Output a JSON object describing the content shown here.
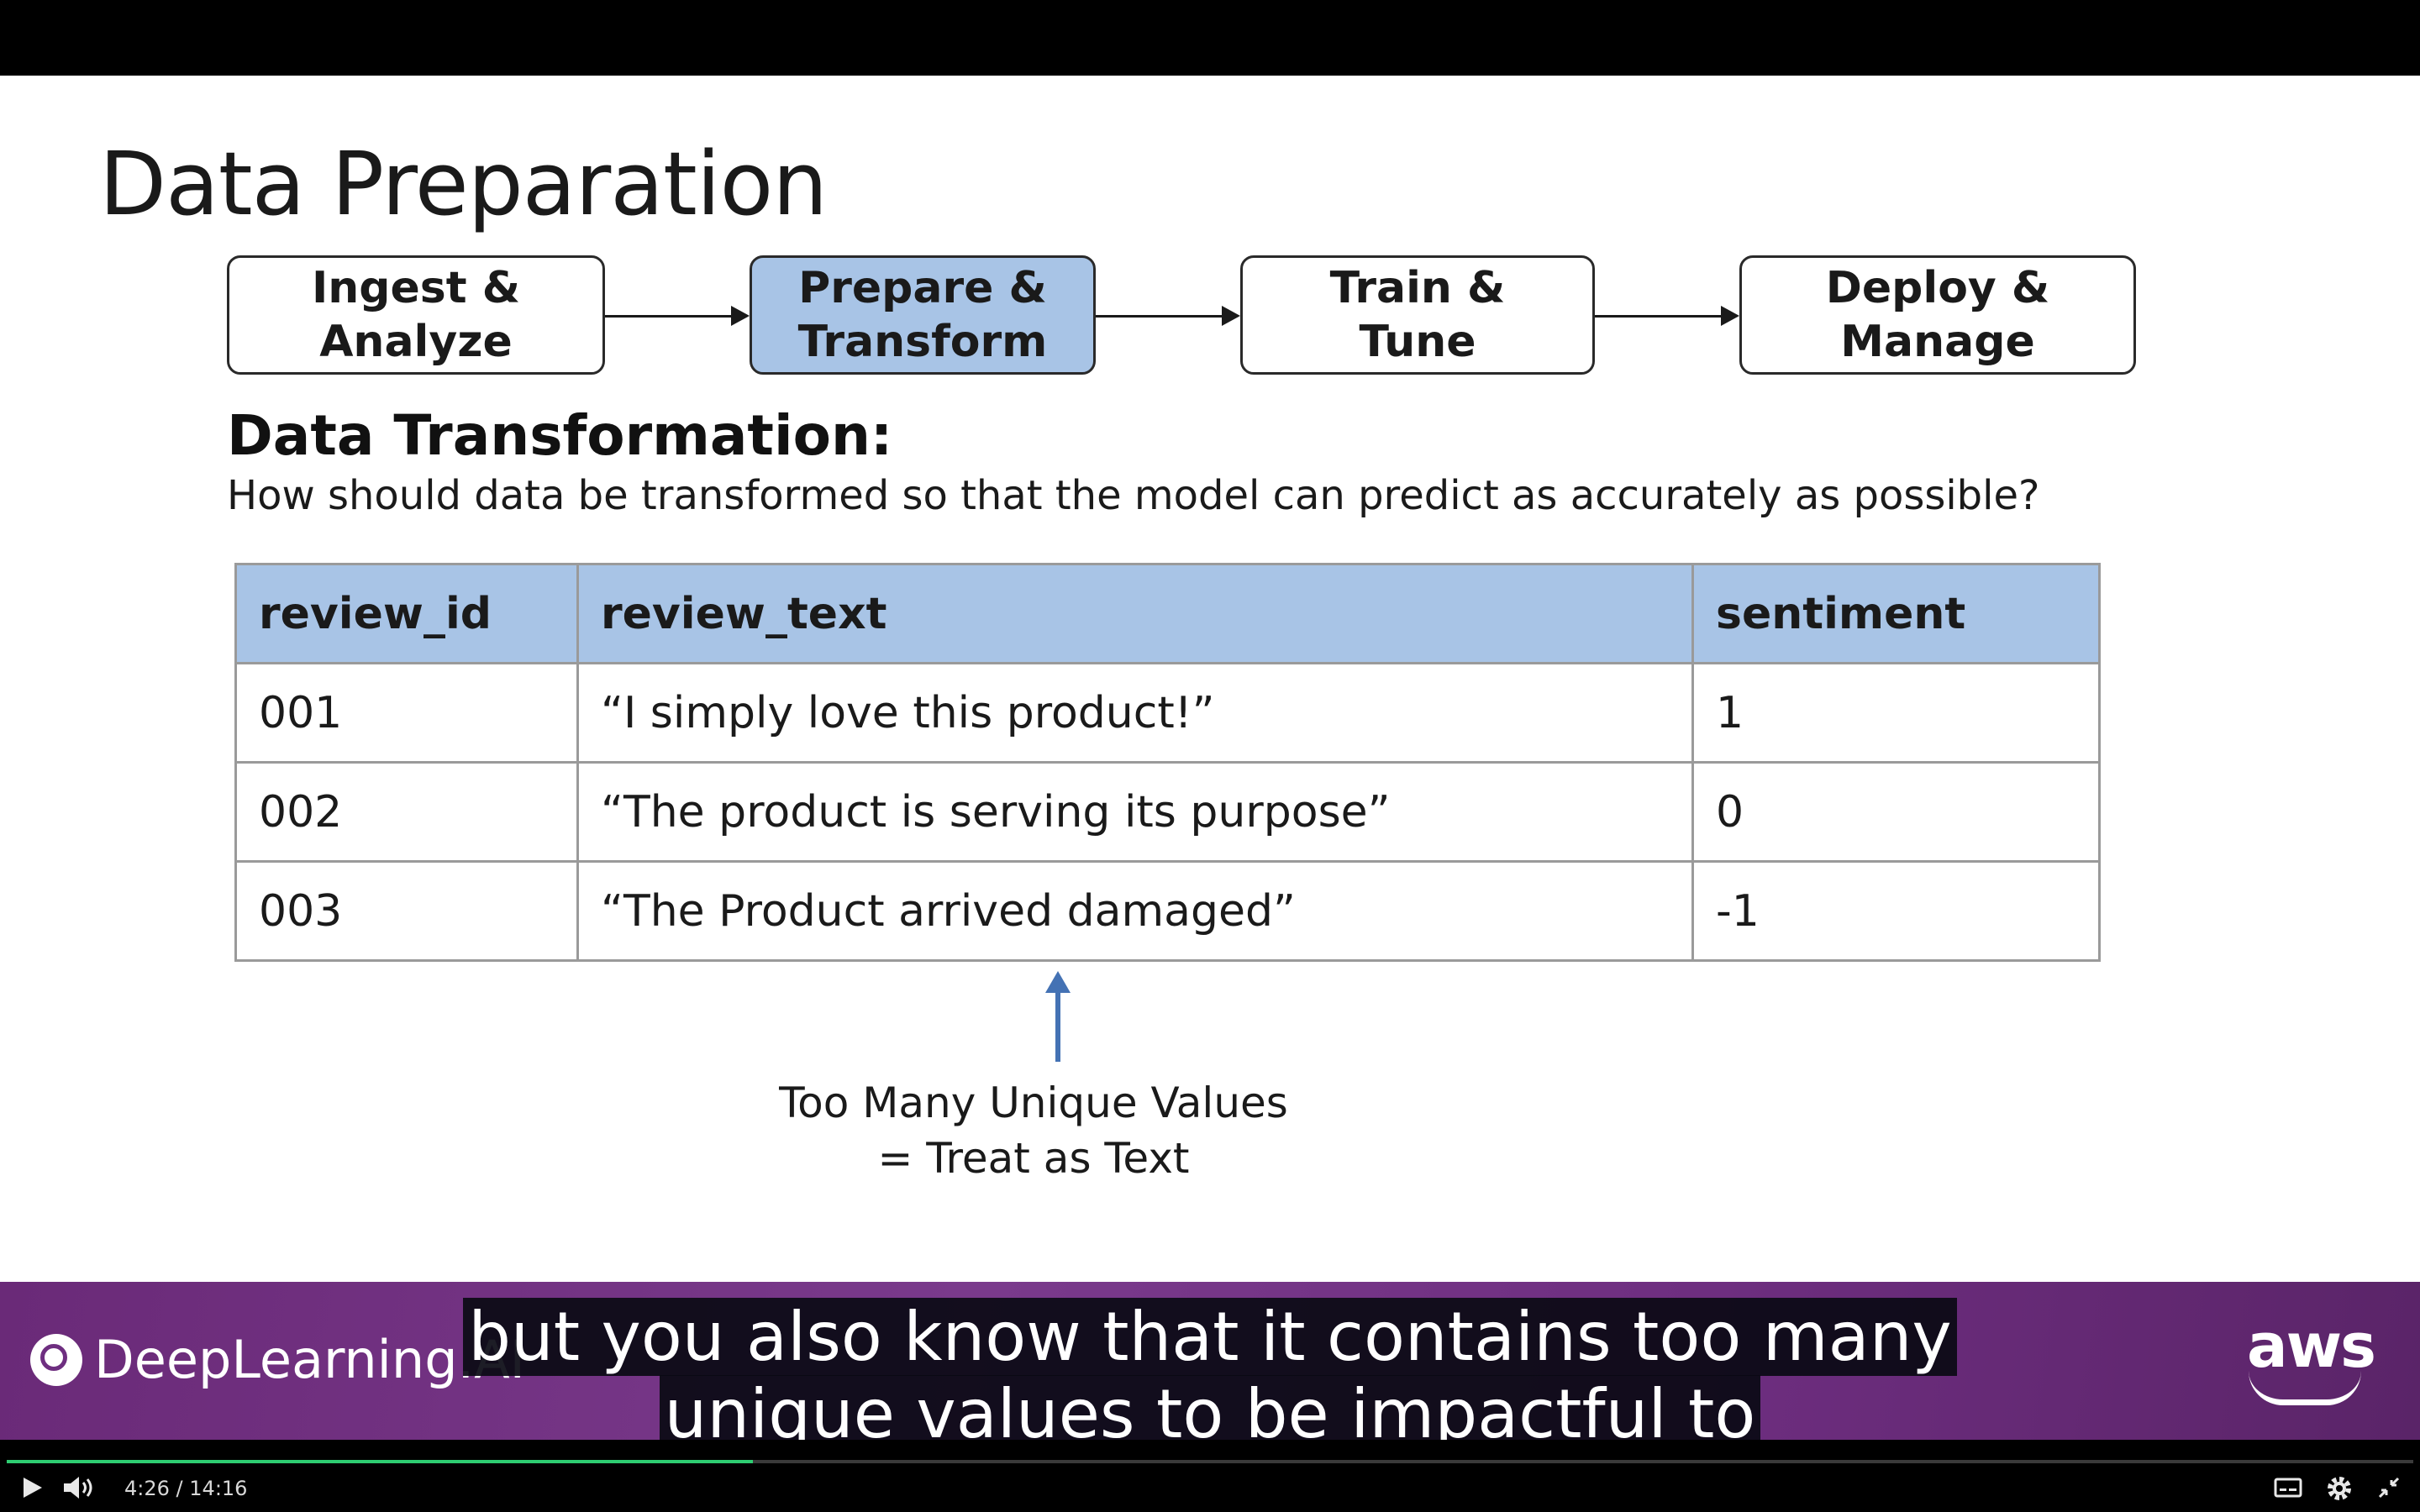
{
  "slide": {
    "title": "Data Preparation",
    "pipeline": [
      "Ingest &\nAnalyze",
      "Prepare &\nTransform",
      "Train &\nTune",
      "Deploy &\nManage"
    ],
    "active_step": "Prepare &\nTransform",
    "section_heading": "Data Transformation:",
    "section_question": "How should data be transformed so that the model can predict as accurately as possible?",
    "table": {
      "headers": [
        "review_id",
        "review_text",
        "sentiment"
      ],
      "rows": [
        [
          "001",
          "“I simply love this product!”",
          "1"
        ],
        [
          "002",
          "“The product is serving its purpose”",
          "0"
        ],
        [
          "003",
          "“The Product arrived damaged”",
          "-1"
        ]
      ]
    },
    "note_line1": "Too Many Unique Values",
    "note_line2": "= Treat as Text"
  },
  "banner": {
    "left_logo": "DeepLearning.AI",
    "right_logo": "aws",
    "colors": {
      "banner": "#6e2e80",
      "highlight": "#a8c4e6"
    }
  },
  "captions": {
    "line1": "but you also know that it contains too many",
    "line2": "unique values to be impactful to"
  },
  "player": {
    "current_time": "4:26",
    "separator": "/",
    "duration": "14:16",
    "progress": 0.31,
    "icons": [
      "play-icon",
      "volume-icon",
      "captions-icon",
      "settings-icon",
      "exit-fullscreen-icon"
    ]
  }
}
